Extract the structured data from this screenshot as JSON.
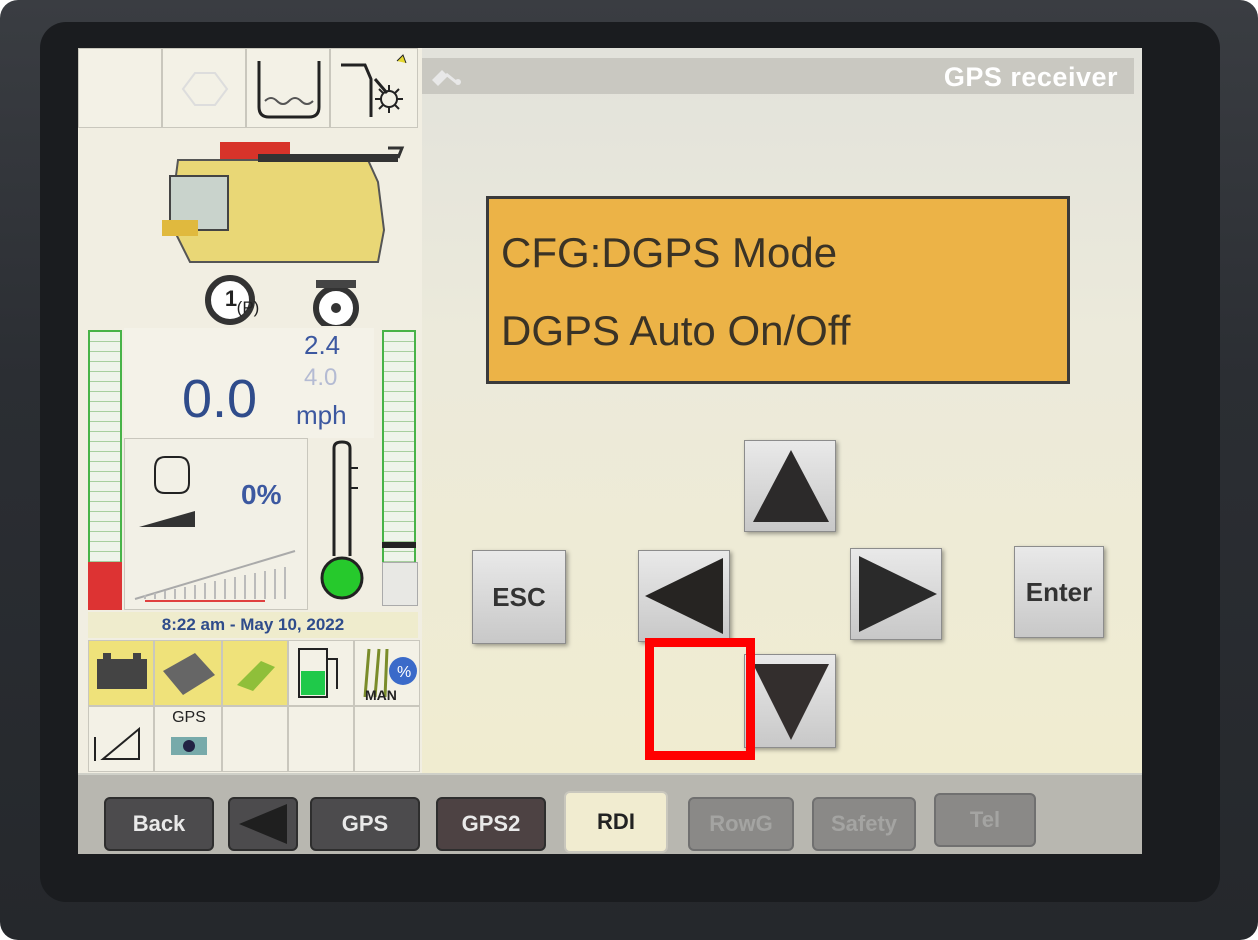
{
  "header": {
    "title": "GPS receiver",
    "icon": "satellite-icon"
  },
  "display": {
    "line1": "CFG:DGPS Mode",
    "line2": "DGPS Auto On/Off"
  },
  "keypad": {
    "esc_label": "ESC",
    "enter_label": "Enter",
    "up_icon": "up-arrow-icon",
    "down_icon": "down-arrow-icon",
    "left_icon": "left-arrow-icon",
    "right_icon": "right-arrow-icon"
  },
  "status": {
    "machine_number": "1",
    "park_label": "(P)",
    "speed_value": "0.0",
    "speed_preset_high": "2.4",
    "speed_preset_low": "4.0",
    "speed_unit": "mph",
    "load_percent": "0%",
    "datetime": "8:22 am - May 10, 2022",
    "gps_label": "GPS",
    "man_label": "MAN"
  },
  "tabs": [
    {
      "label": "Back",
      "state": "dark"
    },
    {
      "label": "◀",
      "state": "dark"
    },
    {
      "label": "GPS",
      "state": "dark"
    },
    {
      "label": "GPS2",
      "state": "dark"
    },
    {
      "label": "RDI",
      "state": "active"
    },
    {
      "label": "RowG",
      "state": "disabled"
    },
    {
      "label": "Safety",
      "state": "disabled"
    },
    {
      "label": "Tel",
      "state": "disabled"
    }
  ],
  "colors": {
    "display_bg": "#ecb347",
    "highlight": "#ff0000",
    "speed_text": "#2f4c8b",
    "gauge_green": "#48b348"
  }
}
